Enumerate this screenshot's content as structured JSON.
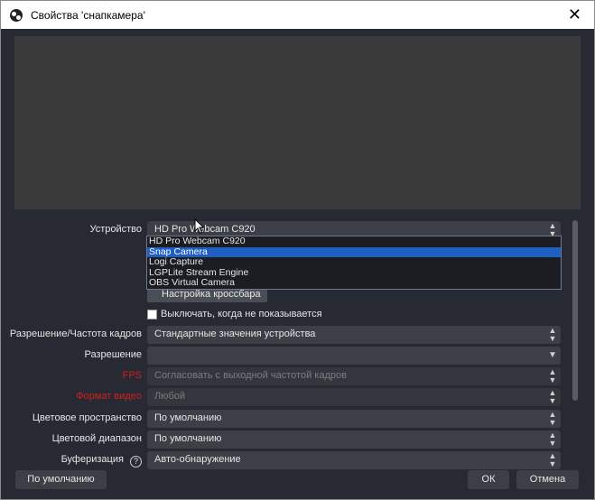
{
  "window": {
    "title": "Свойства 'снапкамера'",
    "close_glyph": "✕"
  },
  "device": {
    "label": "Устройство",
    "value": "HD Pro Webcam C920",
    "options": [
      "HD Pro Webcam C920",
      "Snap Camera",
      "Logi Capture",
      "LGPLite Stream Engine",
      "OBS Virtual Camera"
    ],
    "selected_index": 1
  },
  "crossbar_button": "Настройка кроссбара",
  "deactivate_checkbox": {
    "label": "Выключать, когда не показывается",
    "checked": false
  },
  "resolution_fps_type": {
    "label": "Разрешение/Частота кадров",
    "value": "Стандартные значения устройства"
  },
  "resolution": {
    "label": "Разрешение",
    "value": ""
  },
  "fps": {
    "label": "FPS",
    "value": "Согласовать с выходной частотой кадров"
  },
  "video_format": {
    "label": "Формат видео",
    "value": "Любой"
  },
  "color_space": {
    "label": "Цветовое пространство",
    "value": "По умолчанию"
  },
  "color_range": {
    "label": "Цветовой диапазон",
    "value": "По умолчанию"
  },
  "buffering": {
    "label": "Буферизация",
    "value": "Авто-обнаружение",
    "help_glyph": "?"
  },
  "footer": {
    "defaults": "По умолчанию",
    "ok": "ОК",
    "cancel": "Отмена"
  },
  "icons": {
    "updown": "▲▼",
    "down": "▼"
  },
  "colors": {
    "background": "#272a33",
    "field": "#3c3f46",
    "selection": "#1f5fc2",
    "warning_label": "#d21f1f"
  }
}
